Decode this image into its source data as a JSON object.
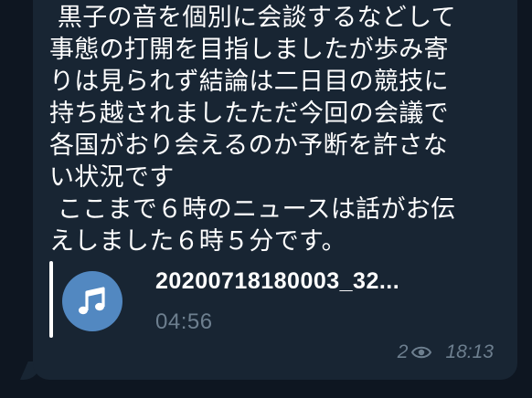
{
  "message": {
    "text": " 黒子の音を個別に会談するなどして\n事態の打開を目指しましたが歩み寄\nりは見られず結論は二日目の競技に\n持ち越されましたただ今回の会議で\n各国がおり会えるのか予断を許さな\nい状況です\n ここまで６時のニュースは話がお伝\nえしました６時５分です。"
  },
  "audio": {
    "filename": "20200718180003_32...",
    "duration": "04:56",
    "icon": "music-note-icon",
    "button_color": "#5288c1"
  },
  "meta": {
    "views": "2",
    "time": "18:13",
    "icon": "eye-icon"
  },
  "colors": {
    "background": "#0e1621",
    "bubble": "#182533",
    "secondary_text": "#6d7f8f"
  }
}
